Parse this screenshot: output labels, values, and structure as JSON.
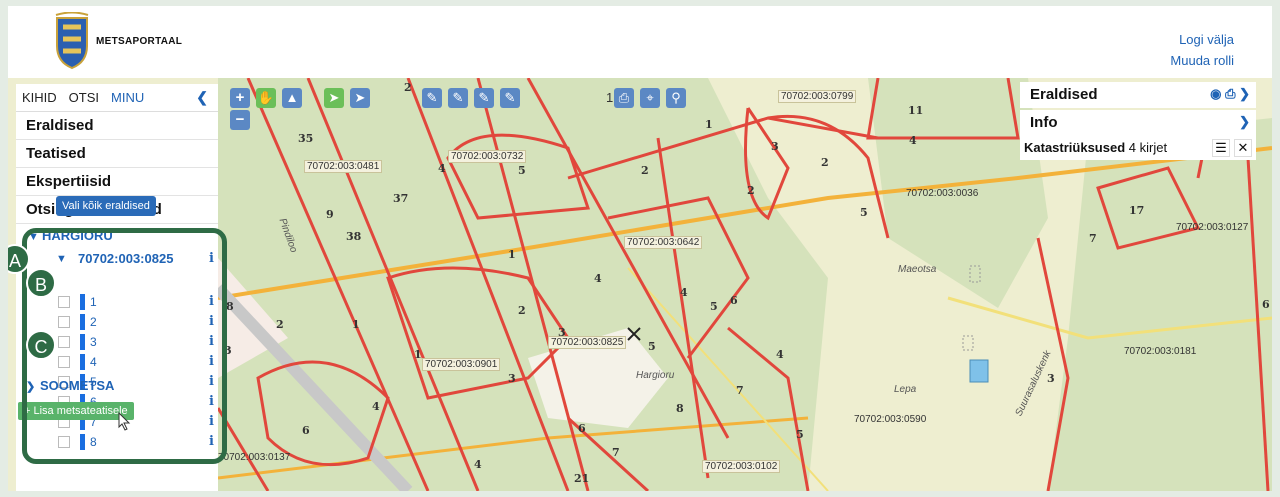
{
  "header": {
    "app_name": "Metsaportaal",
    "logout": "Logi välja",
    "change_role": "Muuda rolli"
  },
  "sidebar": {
    "tabs": [
      "KIHID",
      "OTSI",
      "MINU"
    ],
    "collapse_icon": "chevron-left-icon",
    "sections": [
      "Eraldised",
      "Teatised",
      "Ekspertiisid",
      "Otsingu tulemused"
    ],
    "group_hargioru": "HARGIORU",
    "parcel": "70702:003:0825",
    "select_all": "Vali kõik eraldised",
    "subplots": [
      "1",
      "2",
      "3",
      "4",
      "5",
      "6",
      "7",
      "8"
    ],
    "group_soometsa": "SOOMETSA",
    "add_button": "Lisa metsateatisele"
  },
  "markers": [
    "A",
    "B",
    "C"
  ],
  "toolbar": {
    "zoom_in": "+",
    "zoom_out": "−",
    "number": "1"
  },
  "right_panel": {
    "eraldised": "Eraldised",
    "info": "Info",
    "kat_label": "Katastriüksused",
    "kat_count": "4 kirjet"
  },
  "map": {
    "cadastral_labels": [
      "70702:003:0799",
      "70702:003:0481",
      "70702:003:0732",
      "70702:003:0036",
      "70702:003:0642",
      "70702:003:0127",
      "70702:003:0825",
      "70702:003:0181",
      "70702:003:0901",
      "70702:003:0590",
      "70702:003:0137",
      "70702:003:0102"
    ],
    "stand_numbers": [
      "2",
      "11",
      "35",
      "4",
      "5",
      "1",
      "2",
      "3",
      "2",
      "37",
      "2",
      "5",
      "4",
      "17",
      "38",
      "9",
      "1",
      "7",
      "4",
      "8",
      "2",
      "1",
      "2",
      "3",
      "5",
      "4",
      "6",
      "7",
      "3",
      "1",
      "3",
      "4",
      "8",
      "4",
      "6",
      "5",
      "6",
      "7",
      "4",
      "21",
      "3",
      "6",
      "5"
    ],
    "places": [
      "Pindiloo",
      "Maeotsa",
      "Hargioru",
      "Lepa",
      "Suurasaluskenk"
    ]
  },
  "colors": {
    "map_bg": "#eeeed0",
    "forest": "#d7e3bd",
    "boundary": "#e1473c",
    "road": "#f3b23a",
    "accent": "#1f63b5",
    "highlight_box": "#2e6b45"
  }
}
